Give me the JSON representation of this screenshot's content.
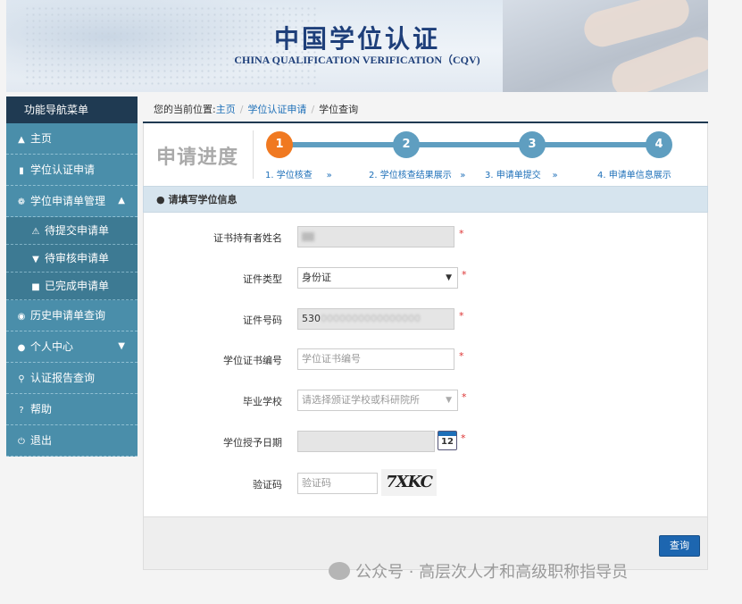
{
  "banner": {
    "title_cn": "中国学位认证",
    "title_en": "CHINA QUALIFICATION VERIFICATION（CQV)"
  },
  "sidebar": {
    "header": "功能导航菜单",
    "items": [
      {
        "label": "主页",
        "icon": "home-icon"
      },
      {
        "label": "学位认证申请",
        "icon": "document-icon"
      },
      {
        "label": "学位申请单管理",
        "icon": "gear-icon",
        "expanded": true
      },
      {
        "label": "待提交申请单",
        "icon": "warning-icon",
        "sub": true
      },
      {
        "label": "待审核申请单",
        "icon": "cart-icon",
        "sub": true
      },
      {
        "label": "已完成申请单",
        "icon": "briefcase-icon",
        "sub": true
      },
      {
        "label": "历史申请单查询",
        "icon": "camera-icon"
      },
      {
        "label": "个人中心",
        "icon": "user-icon",
        "expanded": false
      },
      {
        "label": "认证报告查询",
        "icon": "search-icon"
      },
      {
        "label": "帮助",
        "icon": "help-icon"
      },
      {
        "label": "退出",
        "icon": "power-icon"
      }
    ]
  },
  "breadcrumb": {
    "prefix": "您的当前位置:",
    "home": "主页",
    "level1": "学位认证申请",
    "current": "学位查询"
  },
  "progress": {
    "title": "申请进度",
    "steps": [
      {
        "num": "1",
        "label": "1. 学位核查",
        "active": true
      },
      {
        "num": "2",
        "label": "2. 学位核查结果展示",
        "active": false
      },
      {
        "num": "3",
        "label": "3. 申请单提交",
        "active": false
      },
      {
        "num": "4",
        "label": "4. 申请单信息展示",
        "active": false
      }
    ],
    "arrow": "»"
  },
  "section": {
    "title": "请填写学位信息"
  },
  "form": {
    "holder_name_label": "证书持有者姓名",
    "id_type_label": "证件类型",
    "id_type_value": "身份证",
    "id_number_label": "证件号码",
    "id_number_value": "530",
    "cert_number_label": "学位证书编号",
    "cert_number_placeholder": "学位证书编号",
    "school_label": "毕业学校",
    "school_placeholder": "请选择颁证学校或科研院所",
    "date_label": "学位授予日期",
    "calendar_day": "12",
    "captcha_label": "验证码",
    "captcha_placeholder": "验证码",
    "captcha_text": "7XKC",
    "required_mark": "*"
  },
  "actions": {
    "query_label": "查询"
  },
  "watermark": {
    "text": "公众号 · 高层次人才和高级职称指导员"
  }
}
